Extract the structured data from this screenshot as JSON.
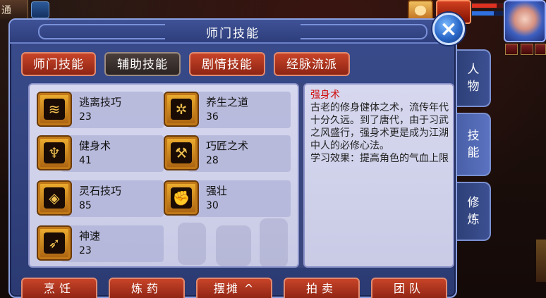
{
  "hud": {
    "top_left_label": "通"
  },
  "window": {
    "title": "师门技能",
    "close_symbol": "×"
  },
  "tabs": [
    {
      "label": "师门技能",
      "active": false
    },
    {
      "label": "辅助技能",
      "active": true
    },
    {
      "label": "剧情技能",
      "active": false
    },
    {
      "label": "经脉流派",
      "active": false
    }
  ],
  "skills": [
    {
      "name": "逃离技巧",
      "level": "23",
      "icon": "flee-skill-icon",
      "glyph": "≋"
    },
    {
      "name": "养生之道",
      "level": "36",
      "icon": "health-cultivation-icon",
      "glyph": "✲"
    },
    {
      "name": "健身术",
      "level": "41",
      "icon": "fitness-skill-icon",
      "glyph": "♆"
    },
    {
      "name": "巧匠之术",
      "level": "28",
      "icon": "craftsman-skill-icon",
      "glyph": "⚒"
    },
    {
      "name": "灵石技巧",
      "level": "85",
      "icon": "spirit-stone-skill-icon",
      "glyph": "◈"
    },
    {
      "name": "强壮",
      "level": "30",
      "icon": "strength-skill-icon",
      "glyph": "✊"
    },
    {
      "name": "神速",
      "level": "23",
      "icon": "speed-skill-icon",
      "glyph": "➶"
    }
  ],
  "description": {
    "title": "强身术",
    "body": "古老的修身健体之术，流传年代十分久远。到了唐代，由于习武之风盛行，强身术更是成为江湖中人的必修心法。",
    "effect": "学习效果：提高角色的气血上限"
  },
  "side_tabs": [
    {
      "label": "人物",
      "active": false
    },
    {
      "label": "技能",
      "active": true
    },
    {
      "label": "修炼",
      "active": false
    }
  ],
  "bottom_buttons": [
    {
      "label": "烹饪"
    },
    {
      "label": "炼药"
    },
    {
      "label": "摆摊 ^"
    },
    {
      "label": "拍卖"
    },
    {
      "label": "团队"
    }
  ],
  "colors": {
    "tab_red": "#c84428",
    "tab_active": "#3a302c",
    "desc_title": "#d01010",
    "window_blue": "#2e3e7c"
  }
}
